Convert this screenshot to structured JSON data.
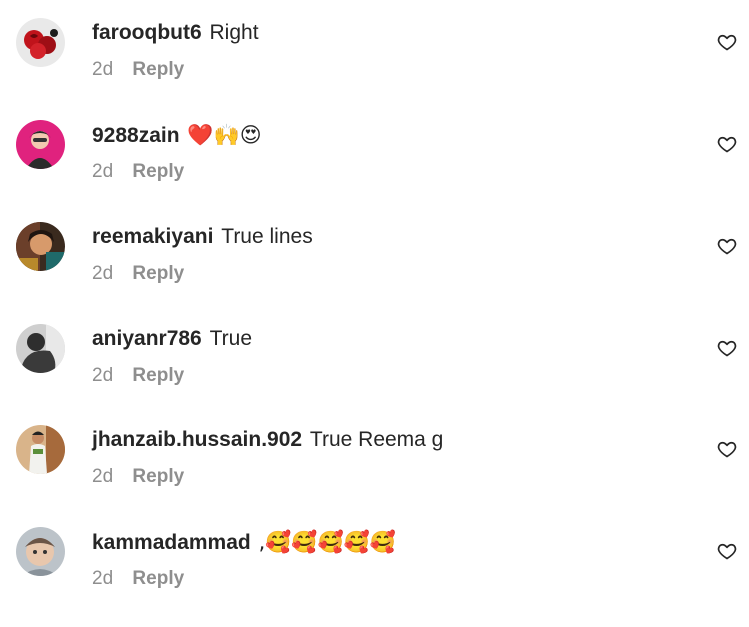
{
  "comments": [
    {
      "username": "farooqbut6",
      "text": "Right",
      "time": "2d",
      "reply": "Reply",
      "avatar": "avatar-red-roses"
    },
    {
      "username": "9288zain",
      "text": "❤️🙌😍",
      "time": "2d",
      "reply": "Reply",
      "avatar": "avatar-pink-person"
    },
    {
      "username": "reemakiyani",
      "text": "True lines",
      "time": "2d",
      "reply": "Reply",
      "avatar": "avatar-colorful-portrait"
    },
    {
      "username": "aniyanr786",
      "text": "True",
      "time": "2d",
      "reply": "Reply",
      "avatar": "avatar-dark-figure"
    },
    {
      "username": "jhanzaib.hussain.902",
      "text": "True Reema g",
      "time": "2d",
      "reply": "Reply",
      "avatar": "avatar-man-standing"
    },
    {
      "username": "kammadammad",
      "text": ",🥰🥰🥰🥰🥰",
      "time": "2d",
      "reply": "Reply",
      "avatar": "avatar-child-photo"
    }
  ],
  "icons": {
    "like": "heart-outline-icon"
  },
  "colors": {
    "username": "#262626",
    "meta": "#8e8e8e",
    "background": "#ffffff"
  }
}
